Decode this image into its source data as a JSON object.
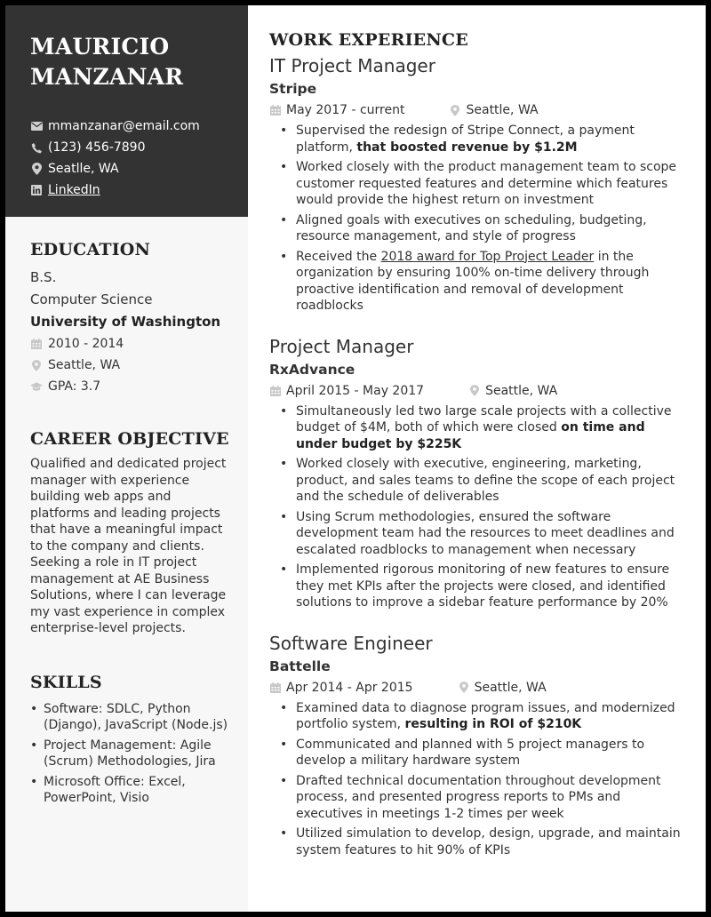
{
  "name_line1": "MAURICIO",
  "name_line2": "MANZANAR",
  "contact": {
    "email": "mmanzanar@email.com",
    "phone": "(123) 456-7890",
    "location": "Seatlle, WA",
    "linkedin": "LinkedIn"
  },
  "education": {
    "title": "EDUCATION",
    "degree": "B.S.",
    "field": "Computer Science",
    "school": "University of Washington",
    "dates": "2010 - 2014",
    "location": "Seattle, WA",
    "gpa": "GPA: 3.7"
  },
  "objective": {
    "title": "CAREER OBJECTIVE",
    "text": "Qualified and dedicated project manager with experience building web apps and platforms and leading projects that have a meaningful impact to the company and clients. Seeking a role in IT project management at AE Business Solutions, where I can leverage my vast experience in complex enterprise-level projects."
  },
  "skills": {
    "title": "SKILLS",
    "items": [
      "Software: SDLC, Python (Django), JavaScript (Node.js)",
      "Project Management: Agile (Scrum) Methodologies, Jira",
      "Microsoft Office: Excel, PowerPoint, Visio"
    ]
  },
  "work": {
    "title": "WORK EXPERIENCE",
    "jobs": [
      {
        "title": "IT Project Manager",
        "company": "Stripe",
        "dates": "May 2017 - current",
        "location": "Seattle, WA",
        "bullets": [
          {
            "pre": "Supervised the redesign of Stripe Connect, a payment platform, ",
            "bold": "that boosted revenue by $1.2M",
            "post": ""
          },
          {
            "pre": "Worked closely with the product management team to scope customer requested features and determine which features would provide the highest return on investment",
            "bold": "",
            "post": ""
          },
          {
            "pre": "Aligned goals with executives on scheduling, budgeting, resource management, and style of progress",
            "bold": "",
            "post": ""
          },
          {
            "pre": "Received the ",
            "underline": "2018 award for Top Project Leader",
            "post": " in the organization by ensuring 100% on-time delivery through proactive identification and removal of development roadblocks"
          }
        ]
      },
      {
        "title": "Project Manager",
        "company": "RxAdvance",
        "dates": "April 2015 - May 2017",
        "location": "Seattle, WA",
        "bullets": [
          {
            "pre": "Simultaneously led two large scale projects with a collective budget of $4M, both of which were closed ",
            "bold": "on time and under budget by $225K",
            "post": ""
          },
          {
            "pre": "Worked closely with executive, engineering, marketing, product, and sales teams to define the scope of each project and the schedule of deliverables",
            "bold": "",
            "post": ""
          },
          {
            "pre": "Using Scrum methodologies, ensured the software development team had the resources to meet deadlines and escalated roadblocks to management when necessary",
            "bold": "",
            "post": ""
          },
          {
            "pre": "Implemented rigorous monitoring of new features to ensure they met KPIs after the projects were closed, and identified solutions to improve a sidebar feature performance by 20%",
            "bold": "",
            "post": ""
          }
        ]
      },
      {
        "title": "Software Engineer",
        "company": "Battelle",
        "dates": "Apr 2014 - Apr 2015",
        "location": "Seattle, WA",
        "bullets": [
          {
            "pre": "Examined data to diagnose program issues, and modernized portfolio system, ",
            "bold": "resulting in ROI of $210K",
            "post": ""
          },
          {
            "pre": "Communicated and planned with 5 project managers to develop a military hardware system",
            "bold": "",
            "post": ""
          },
          {
            "pre": "Drafted technical documentation throughout development process, and presented progress reports to PMs and executives in meetings 1-2 times per week",
            "bold": "",
            "post": ""
          },
          {
            "pre": "Utilized simulation to develop, design, upgrade, and maintain system features to hit 90% of KPIs",
            "bold": "",
            "post": ""
          }
        ]
      }
    ]
  }
}
